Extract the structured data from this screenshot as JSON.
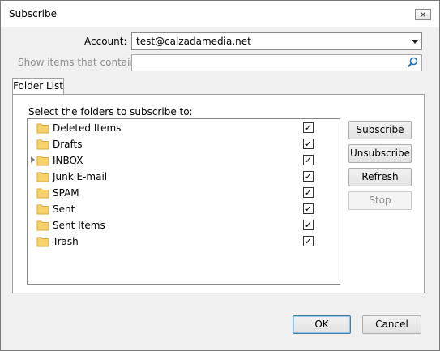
{
  "window": {
    "title": "Subscribe"
  },
  "form": {
    "account_label": "Account:",
    "account_value": "test@calzadamedia.net",
    "show_items_label": "Show items that contain:",
    "show_items_value": ""
  },
  "tabs": [
    {
      "label": "Folder List",
      "selected": true
    }
  ],
  "folder_panel": {
    "instruction": "Select the folders to subscribe to:",
    "folders": [
      {
        "name": "Deleted Items",
        "checked": true,
        "expandable": false
      },
      {
        "name": "Drafts",
        "checked": true,
        "expandable": false
      },
      {
        "name": "INBOX",
        "checked": true,
        "expandable": true
      },
      {
        "name": "Junk E-mail",
        "checked": true,
        "expandable": false
      },
      {
        "name": "SPAM",
        "checked": true,
        "expandable": false
      },
      {
        "name": "Sent",
        "checked": true,
        "expandable": false
      },
      {
        "name": "Sent Items",
        "checked": true,
        "expandable": false
      },
      {
        "name": "Trash",
        "checked": true,
        "expandable": false
      }
    ]
  },
  "side_buttons": {
    "subscribe": "Subscribe",
    "unsubscribe": "Unsubscribe",
    "refresh": "Refresh",
    "stop": "Stop"
  },
  "footer": {
    "ok": "OK",
    "cancel": "Cancel"
  },
  "icons": {
    "close": "close-icon",
    "search": "search-icon",
    "folder": "folder-icon",
    "check": "check-icon"
  },
  "colors": {
    "folder_yellow": "#f5d26b",
    "accent": "#3c7fb1"
  }
}
